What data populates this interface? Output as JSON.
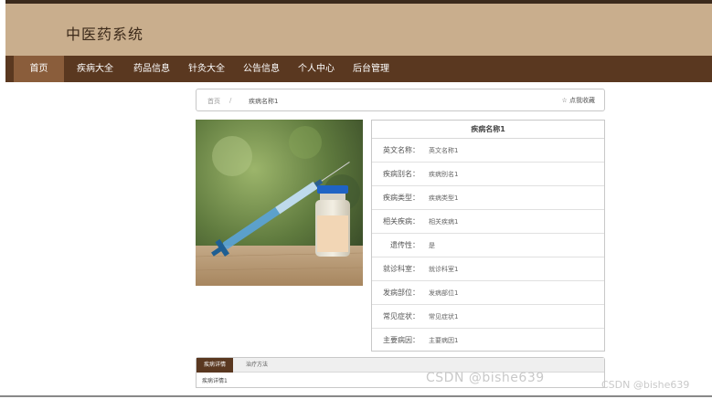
{
  "site": {
    "title": "中医药系统"
  },
  "nav": {
    "items": [
      "首页",
      "疾病大全",
      "药品信息",
      "针灸大全",
      "公告信息",
      "个人中心",
      "后台管理"
    ]
  },
  "breadcrumb": {
    "home": "首页",
    "separator": "/",
    "current": "疾病名称1",
    "favorite": "☆ 点我收藏"
  },
  "detail": {
    "title": "疾病名称1",
    "fields": [
      {
        "label": "英文名称：",
        "value": "英文名称1"
      },
      {
        "label": "疾病别名：",
        "value": "疾病别名1"
      },
      {
        "label": "疾病类型：",
        "value": "疾病类型1"
      },
      {
        "label": "相关疾病：",
        "value": "相关疾病1"
      },
      {
        "label": "遗传性：",
        "value": "是"
      },
      {
        "label": "就诊科室：",
        "value": "就诊科室1"
      },
      {
        "label": "发病部位：",
        "value": "发病部位1"
      },
      {
        "label": "常见症状：",
        "value": "常见症状1"
      },
      {
        "label": "主要病因：",
        "value": "主要病因1"
      }
    ]
  },
  "tabs": {
    "items": [
      "疾病详情",
      "治疗方法"
    ],
    "active_content": "疾病详情1"
  },
  "watermark": {
    "main": "CSDN @bishe639",
    "secondary": "CSDN @bishe639"
  },
  "colors": {
    "header": "#c9ae8d",
    "nav": "#5a3820",
    "nav_active": "#8a5d3b"
  }
}
